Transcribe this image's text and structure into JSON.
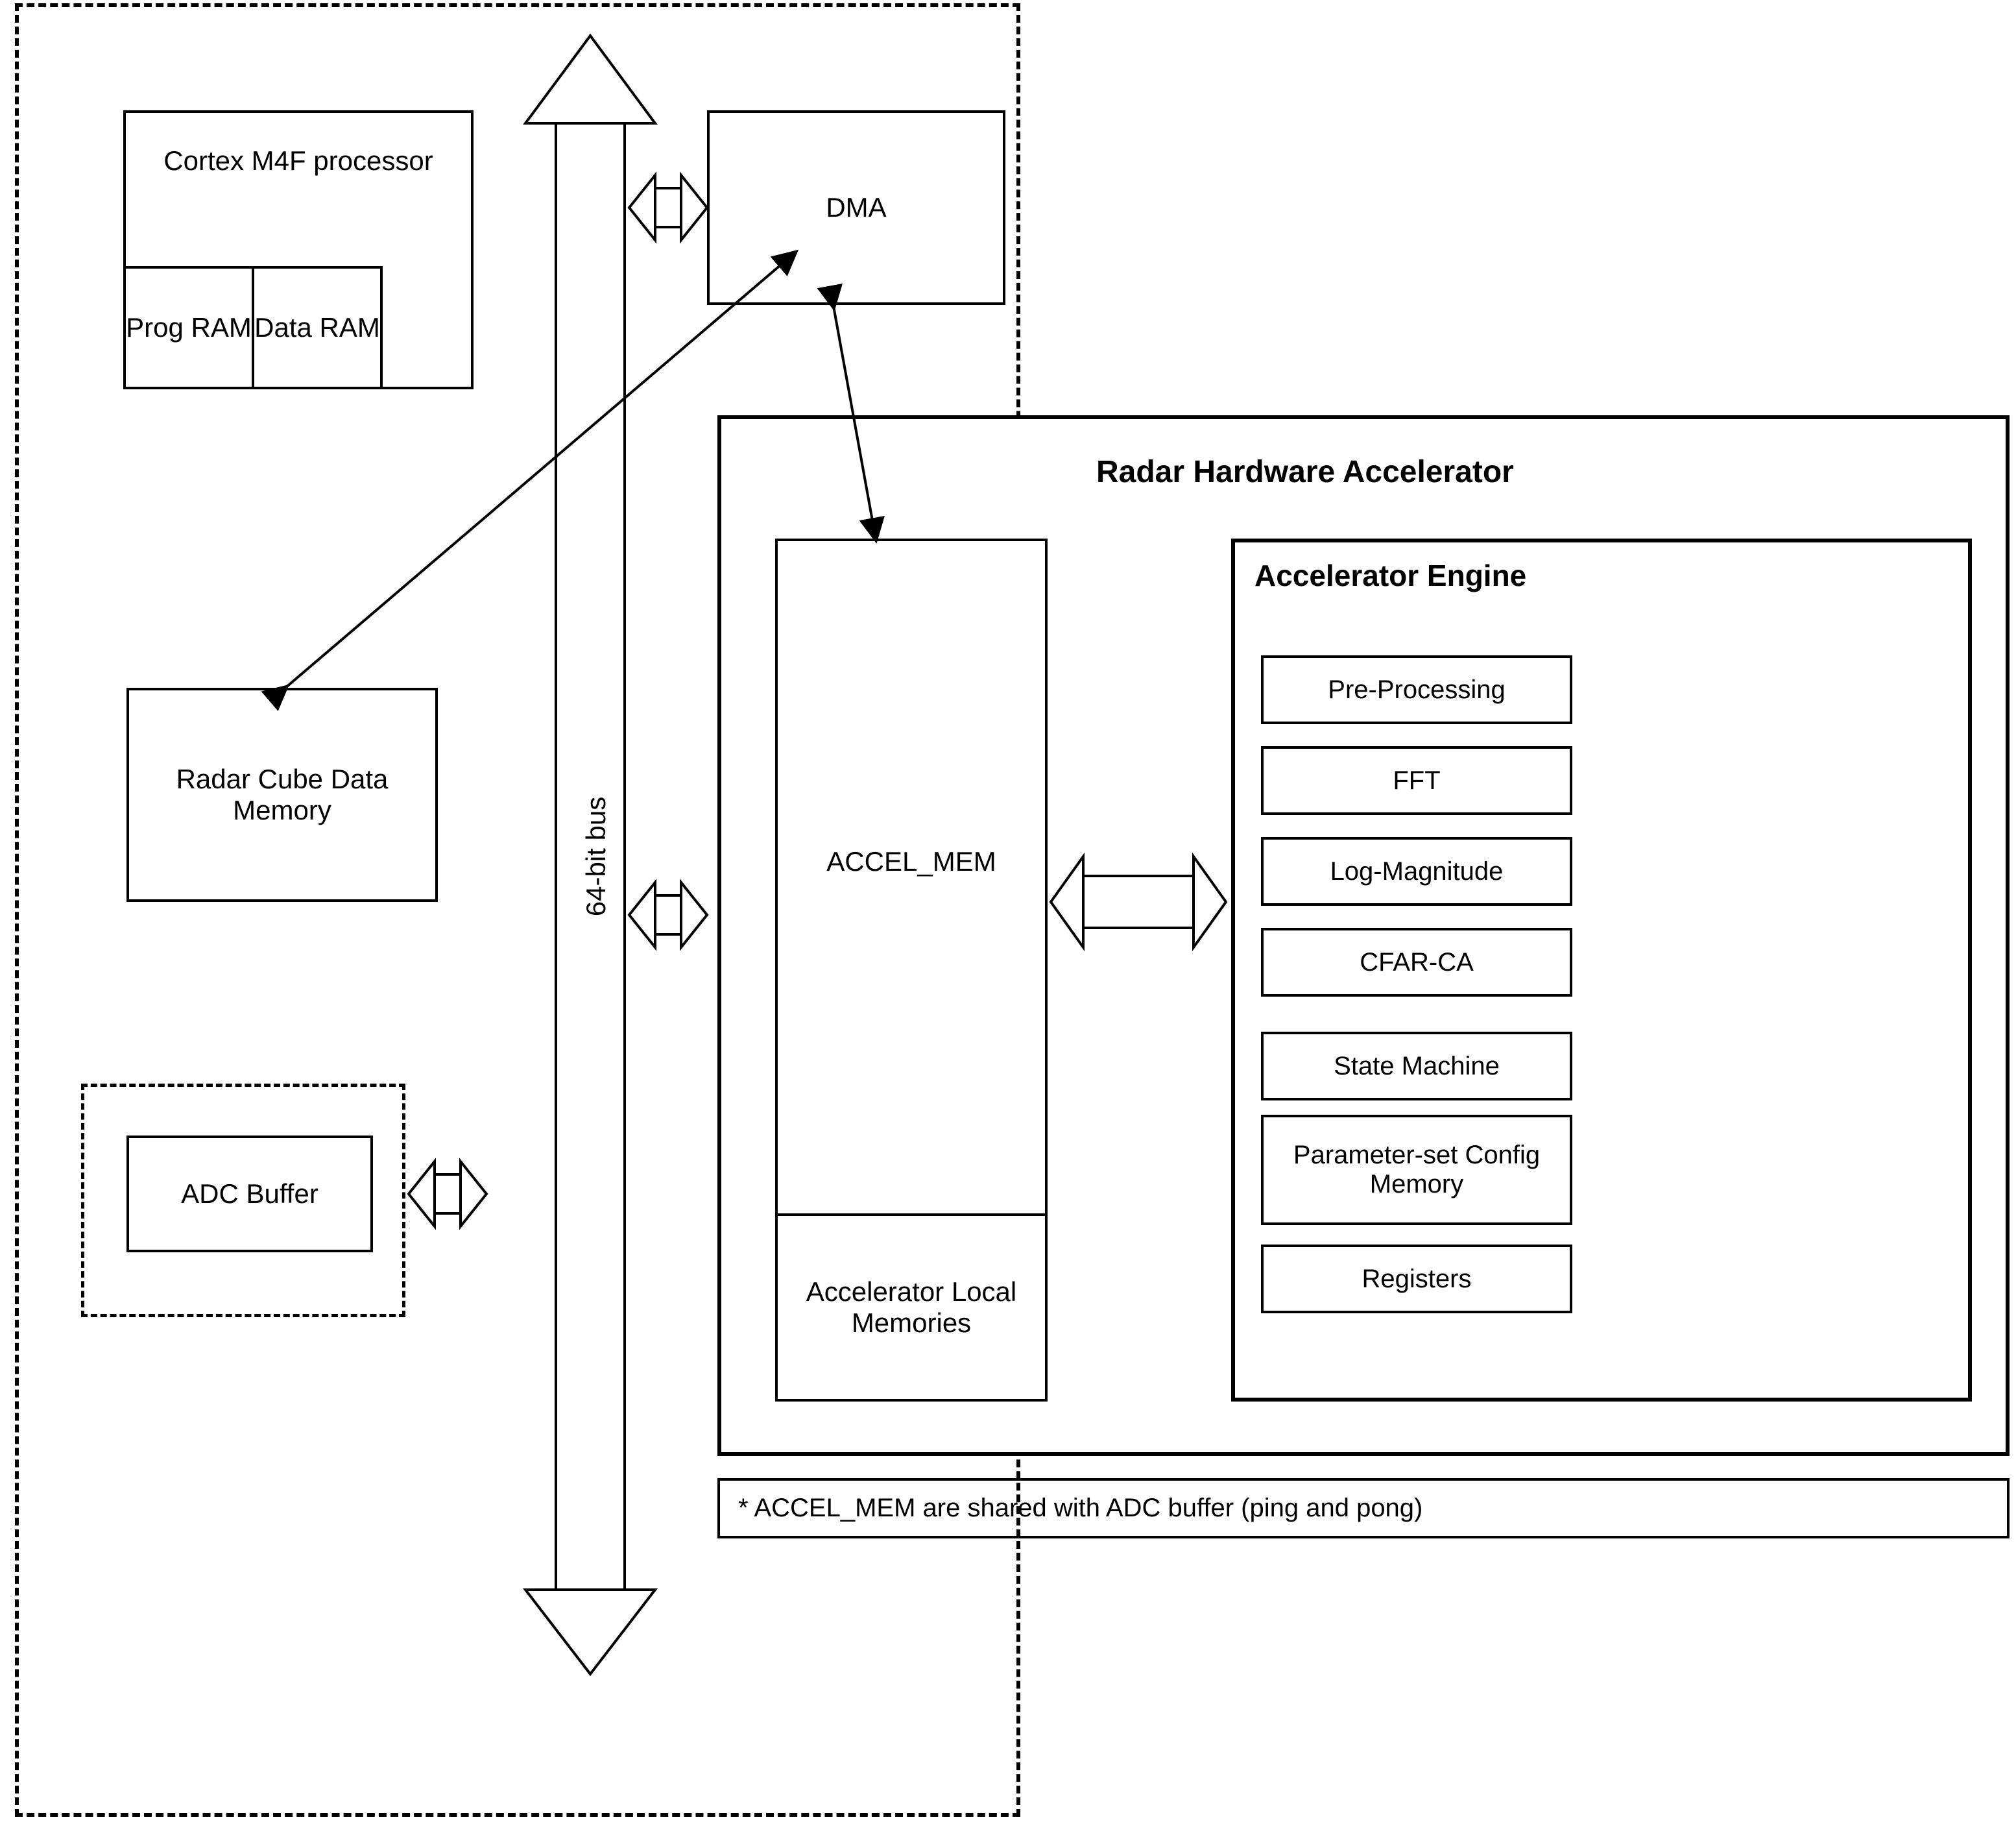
{
  "blocks": {
    "processor": "Cortex M4F processor",
    "prog_ram": "Prog RAM",
    "data_ram": "Data RAM",
    "dma": "DMA",
    "radar_cube": "Radar Cube Data Memory",
    "adc_buffer": "ADC Buffer",
    "accel_mem_title": "ACCEL_MEM",
    "accel_mem_sub": "Accelerator Local Memories",
    "hw_accel_title": "Radar Hardware Accelerator",
    "engine_title": "Accelerator Engine",
    "engine_items": [
      "Pre-Processing",
      "FFT",
      "Log-Magnitude",
      "CFAR-CA",
      "State Machine",
      "Parameter-set Config Memory",
      "Registers"
    ]
  },
  "bus_label": "64-bit bus",
  "footnote": "* ACCEL_MEM are shared with ADC buffer (ping and pong)"
}
